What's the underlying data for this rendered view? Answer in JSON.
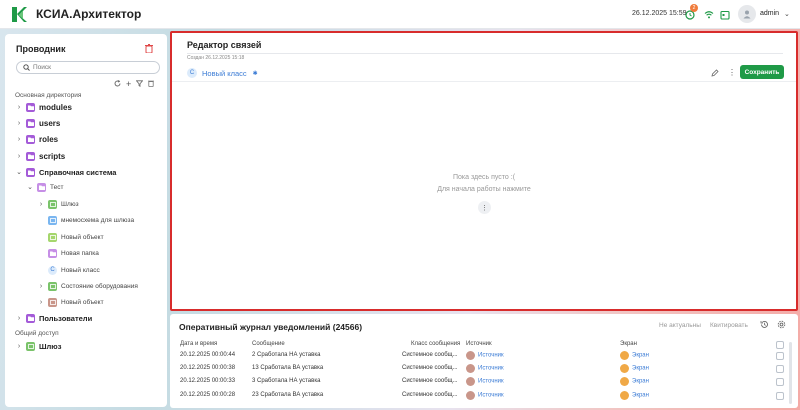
{
  "header": {
    "app_title": "КСИА.Архитектор",
    "datetime": "26.12.2025 15:59",
    "notifications_count": "2",
    "username": "admin",
    "colors": {
      "brand": "#1f9a47",
      "badge": "#f07c3c"
    }
  },
  "sidebar": {
    "title": "Проводник",
    "search_placeholder": "Поиск",
    "section_main": "Основная директория",
    "section_shared": "Общий доступ",
    "items": [
      {
        "label": "modules"
      },
      {
        "label": "users"
      },
      {
        "label": "roles"
      },
      {
        "label": "scripts"
      },
      {
        "label": "Справочная система"
      },
      {
        "label": "Тест"
      },
      {
        "label": "Шлюз"
      },
      {
        "label": "мнемосхема для шлюза"
      },
      {
        "label": "Новый объект"
      },
      {
        "label": "Новая папка"
      },
      {
        "label": "Новый класс"
      },
      {
        "label": "Состояние оборудования"
      },
      {
        "label": "Новый объект"
      },
      {
        "label": "Пользователи"
      },
      {
        "label": "Шлюз"
      }
    ]
  },
  "editor": {
    "title": "Редактор связей",
    "created": "Создан 26.12.2025 15:18",
    "class_name": "Новый класс",
    "class_letter": "C",
    "save_label": "Сохранить",
    "empty_line1": "Пока здесь пусто :(",
    "empty_line2": "Для начала работы нажмите"
  },
  "journal": {
    "title": "Оперативный журнал уведомлений (24566)",
    "btn_irrelevant": "Не актуальны",
    "btn_quittance": "Квитировать",
    "columns": [
      "Дата и время",
      "Сообщение",
      "Класс сообщения",
      "Источник",
      "Экран"
    ],
    "rows": [
      {
        "date": "20.12.2025 00:00:44",
        "message": "2 Сработала НА уставка",
        "class": "Системное сообщ...",
        "source": "Источник",
        "screen": "Экран"
      },
      {
        "date": "20.12.2025 00:00:38",
        "message": "13 Сработала ВА уставка",
        "class": "Системное сообщ...",
        "source": "Источник",
        "screen": "Экран"
      },
      {
        "date": "20.12.2025 00:00:33",
        "message": "3 Сработала НА уставка",
        "class": "Системное сообщ...",
        "source": "Источник",
        "screen": "Экран"
      },
      {
        "date": "20.12.2025 00:00:28",
        "message": "23 Сработала ВА уставка",
        "class": "Системное сообщ...",
        "source": "Источник",
        "screen": "Экран"
      }
    ]
  }
}
